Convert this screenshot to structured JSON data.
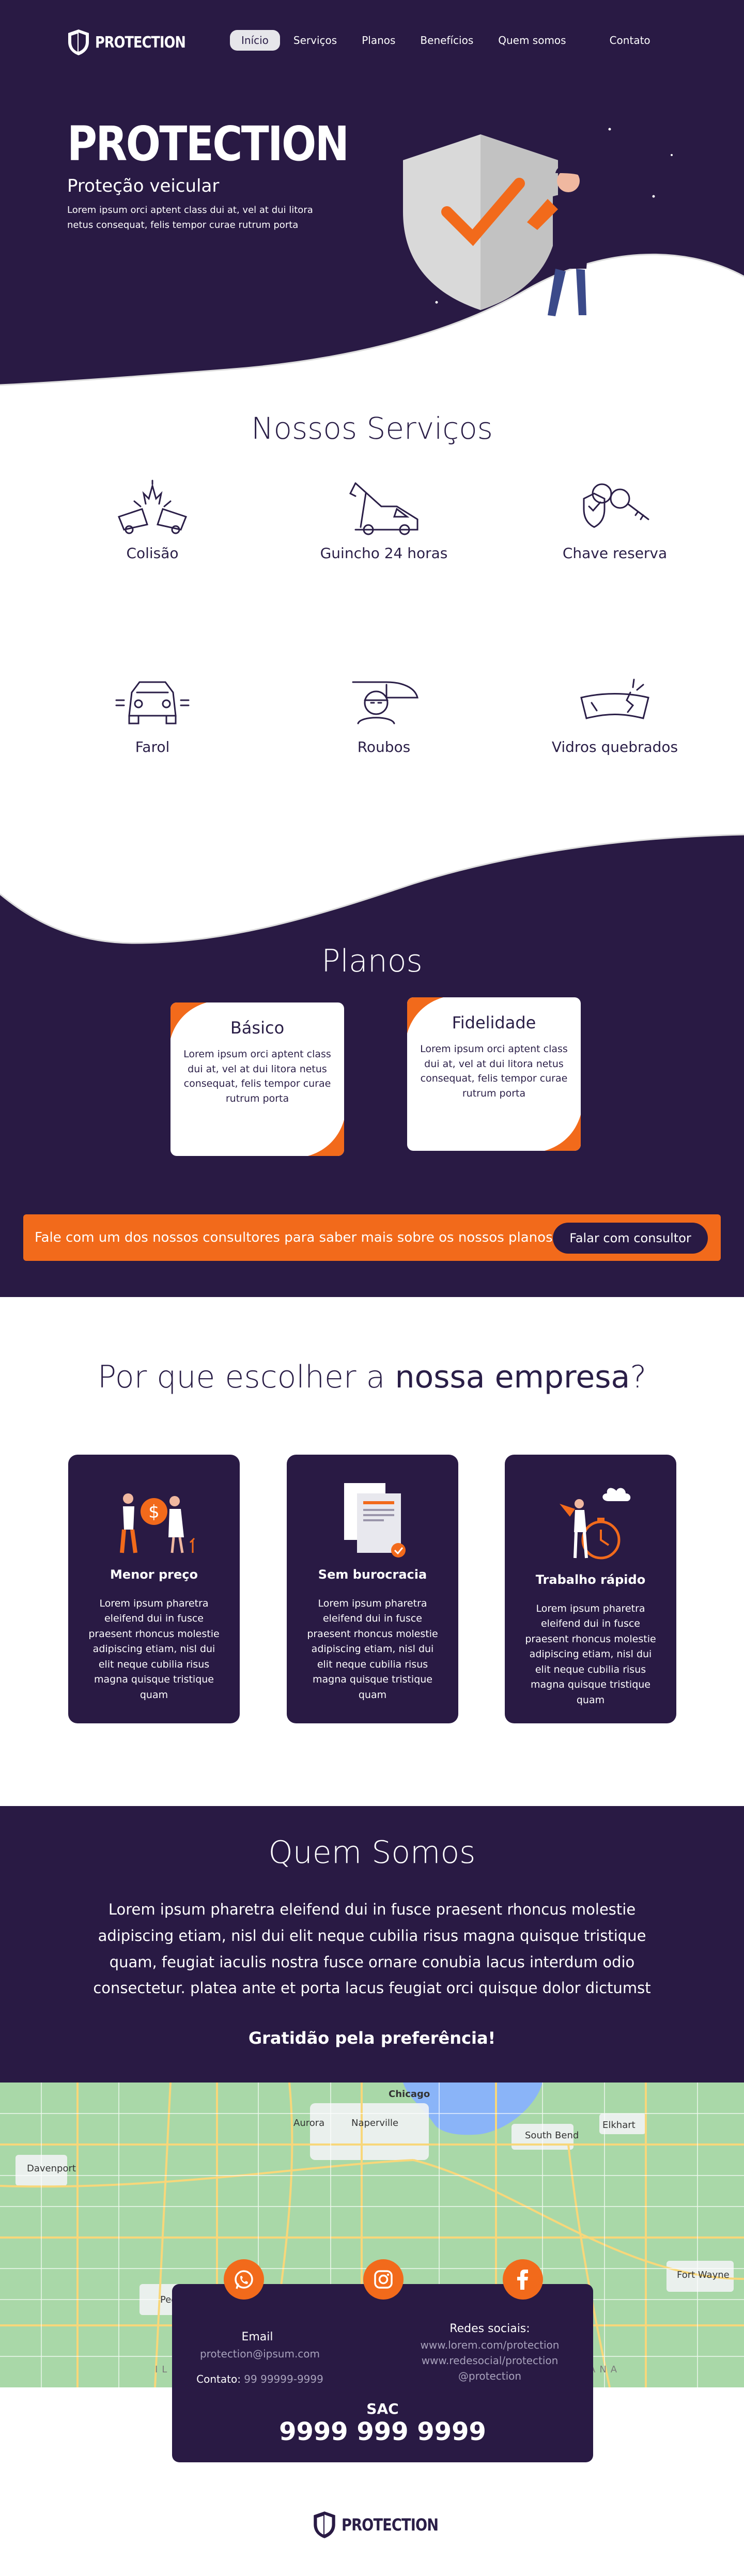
{
  "brand": {
    "name": "PROTECTION"
  },
  "nav": {
    "items": [
      "Início",
      "Serviços",
      "Planos",
      "Benefícios",
      "Quem somos",
      "Contato"
    ],
    "active": "Início"
  },
  "hero": {
    "title": "PROTECTION",
    "subtitle": "Proteção veicular",
    "text": "Lorem ipsum orci aptent class dui at, vel at dui litora netus consequat, felis tempor curae rutrum porta"
  },
  "services": {
    "title": "Nossos Serviços",
    "items": [
      {
        "label": "Colisão",
        "icon": "collision-icon"
      },
      {
        "label": "Guincho 24 horas",
        "icon": "tow-truck-icon"
      },
      {
        "label": "Chave reserva",
        "icon": "spare-key-icon"
      },
      {
        "label": "Farol",
        "icon": "headlight-icon"
      },
      {
        "label": "Roubos",
        "icon": "theft-icon"
      },
      {
        "label": "Vidros quebrados",
        "icon": "broken-glass-icon"
      }
    ]
  },
  "plans": {
    "title": "Planos",
    "items": [
      {
        "name": "Básico",
        "desc": "Lorem ipsum orci aptent class dui at, vel at dui litora netus consequat, felis tempor curae rutrum porta"
      },
      {
        "name": "Fidelidade",
        "desc": "Lorem ipsum orci aptent class dui at, vel at dui litora netus consequat, felis tempor curae rutrum porta"
      }
    ],
    "cta_text": "Fale com um dos nossos consultores para saber mais sobre os nossos planos",
    "cta_button": "Falar com consultor"
  },
  "why": {
    "title_start": "Por que escolher a ",
    "title_bold": "nossa empresa",
    "title_end": "?",
    "items": [
      {
        "head": "Menor preço",
        "desc": "Lorem ipsum pharetra eleifend dui in fusce praesent rhoncus molestie adipiscing etiam, nisl dui elit neque cubilia risus magna quisque tristique quam"
      },
      {
        "head": "Sem burocracia",
        "desc": "Lorem ipsum pharetra eleifend dui in fusce praesent rhoncus molestie adipiscing etiam, nisl dui elit neque cubilia risus magna quisque tristique quam"
      },
      {
        "head": "Trabalho rápido",
        "desc": "Lorem ipsum pharetra eleifend dui in fusce praesent rhoncus molestie adipiscing etiam, nisl dui elit neque cubilia risus magna quisque tristique quam"
      }
    ]
  },
  "about": {
    "title": "Quem Somos",
    "text": "Lorem ipsum pharetra eleifend dui in fusce praesent rhoncus molestie adipiscing etiam, nisl dui elit neque cubilia risus magna quisque tristique quam, feugiat iaculis nostra fusce ornare conubia lacus interdum odio consectetur. platea ante et porta lacus feugiat orci quisque dolor dictumst",
    "thanks": "Gratidão pela preferência!"
  },
  "map": {
    "labels": [
      "Chicago",
      "Aurora",
      "Naperville",
      "South Bend",
      "Elkhart",
      "Davenport",
      "Peoria",
      "Fort Wayne",
      "IL",
      "ANA"
    ]
  },
  "contact": {
    "email_label": "Email",
    "email_value": "protection@ipsum.com",
    "phone_label": "Contato:",
    "phone_value": "99 99999-9999",
    "social_label": "Redes sociais:",
    "social_links": [
      "www.lorem.com/protection",
      "www.redesocial/protection",
      "@protection"
    ],
    "sac_label": "SAC",
    "sac_phone": "9999 999 9999"
  },
  "colors": {
    "purple": "#291a44",
    "orange": "#f26a1b",
    "white": "#ffffff"
  }
}
